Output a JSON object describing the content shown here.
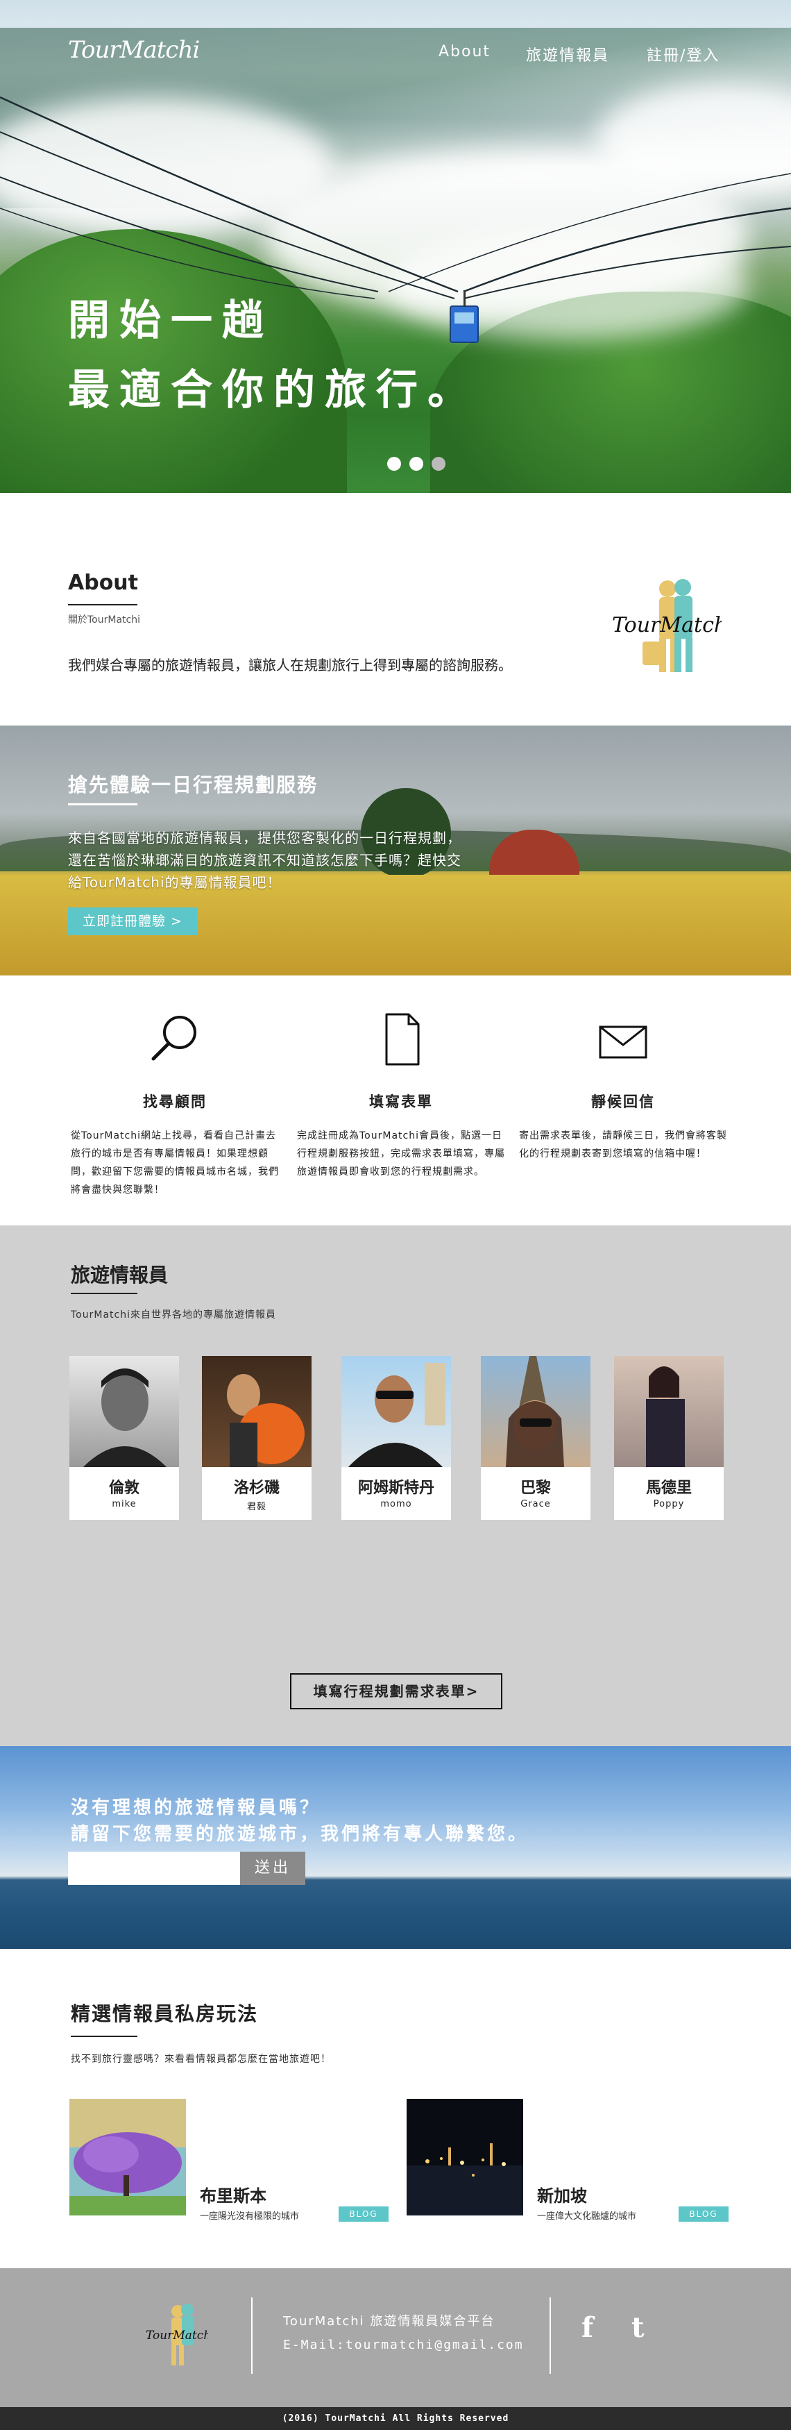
{
  "brand": {
    "logo_text": "TourMatchi"
  },
  "nav": {
    "items": [
      "About",
      "旅遊情報員",
      "註冊/登入"
    ]
  },
  "hero": {
    "line1": "開始一趟",
    "line2": "最適合你的旅行。"
  },
  "about": {
    "title": "About",
    "subtitle": "關於TourMatchi",
    "description": "我們媒合專屬的旅遊情報員，讓旅人在規劃旅行上得到專屬的諮詢服務。"
  },
  "trial": {
    "title": "搶先體驗一日行程規劃服務",
    "line1": "來自各國當地的旅遊情報員，提供您客製化的一日行程規劃，",
    "line2": "還在苦惱於琳瑯滿目的旅遊資訊不知道該怎麼下手嗎？趕快交",
    "line3": "給TourMatchi的專屬情報員吧！",
    "button": "立即註冊體驗 >"
  },
  "steps": [
    {
      "icon": "search-icon",
      "title": "找尋顧問",
      "text": "從TourMatchi網站上找尋，看看自己計畫去旅行的城市是否有專屬情報員！如果理想顧問，歡迎留下您需要的情報員城市名城，我們將會盡快與您聯繫！"
    },
    {
      "icon": "document-icon",
      "title": "填寫表單",
      "text": "完成註冊成為TourMatchi會員後，點選一日行程規劃服務按鈕，完成需求表單填寫，專屬旅遊情報員即會收到您的行程規劃需求。"
    },
    {
      "icon": "envelope-icon",
      "title": "靜候回信",
      "text": "寄出需求表單後，請靜候三日，我們會將客製化的行程規劃表寄到您填寫的信箱中喔！"
    }
  ],
  "guides": {
    "title": "旅遊情報員",
    "subtitle": "TourMatchi來自世界各地的專屬旅遊情報員",
    "people": [
      {
        "name": "倫敦",
        "en": "mike"
      },
      {
        "name": "洛杉磯",
        "en": "君毅"
      },
      {
        "name": "阿姆斯特丹",
        "en": "momo"
      },
      {
        "name": "巴黎",
        "en": "Grace"
      },
      {
        "name": "馬德里",
        "en": "Poppy"
      }
    ],
    "form_button": "填寫行程規劃需求表單>"
  },
  "subscribe": {
    "line1": "沒有理想的旅遊情報員嗎？",
    "line2": "請留下您需要的旅遊城市，我們將有專人聯繫您。",
    "input_value": "",
    "button": "送出"
  },
  "blog": {
    "title": "精選情報員私房玩法",
    "subtitle": "找不到旅行靈感嗎？來看看情報員都怎麼在當地旅遊吧！",
    "posts": [
      {
        "title": "布里斯本",
        "caption": "一座陽光沒有極限的城市",
        "tag": "BLOG"
      },
      {
        "title": "新加坡",
        "caption": "一座偉大文化融爐的城市",
        "tag": "BLOG"
      }
    ]
  },
  "footer": {
    "line1": "TourMatchi 旅遊情報員媒合平台",
    "line2": "E-Mail:tourmatchi@gmail.com",
    "facebook": "f",
    "twitter": "t",
    "copyright": "(2016) TourMatchi All Rights Reserved"
  }
}
